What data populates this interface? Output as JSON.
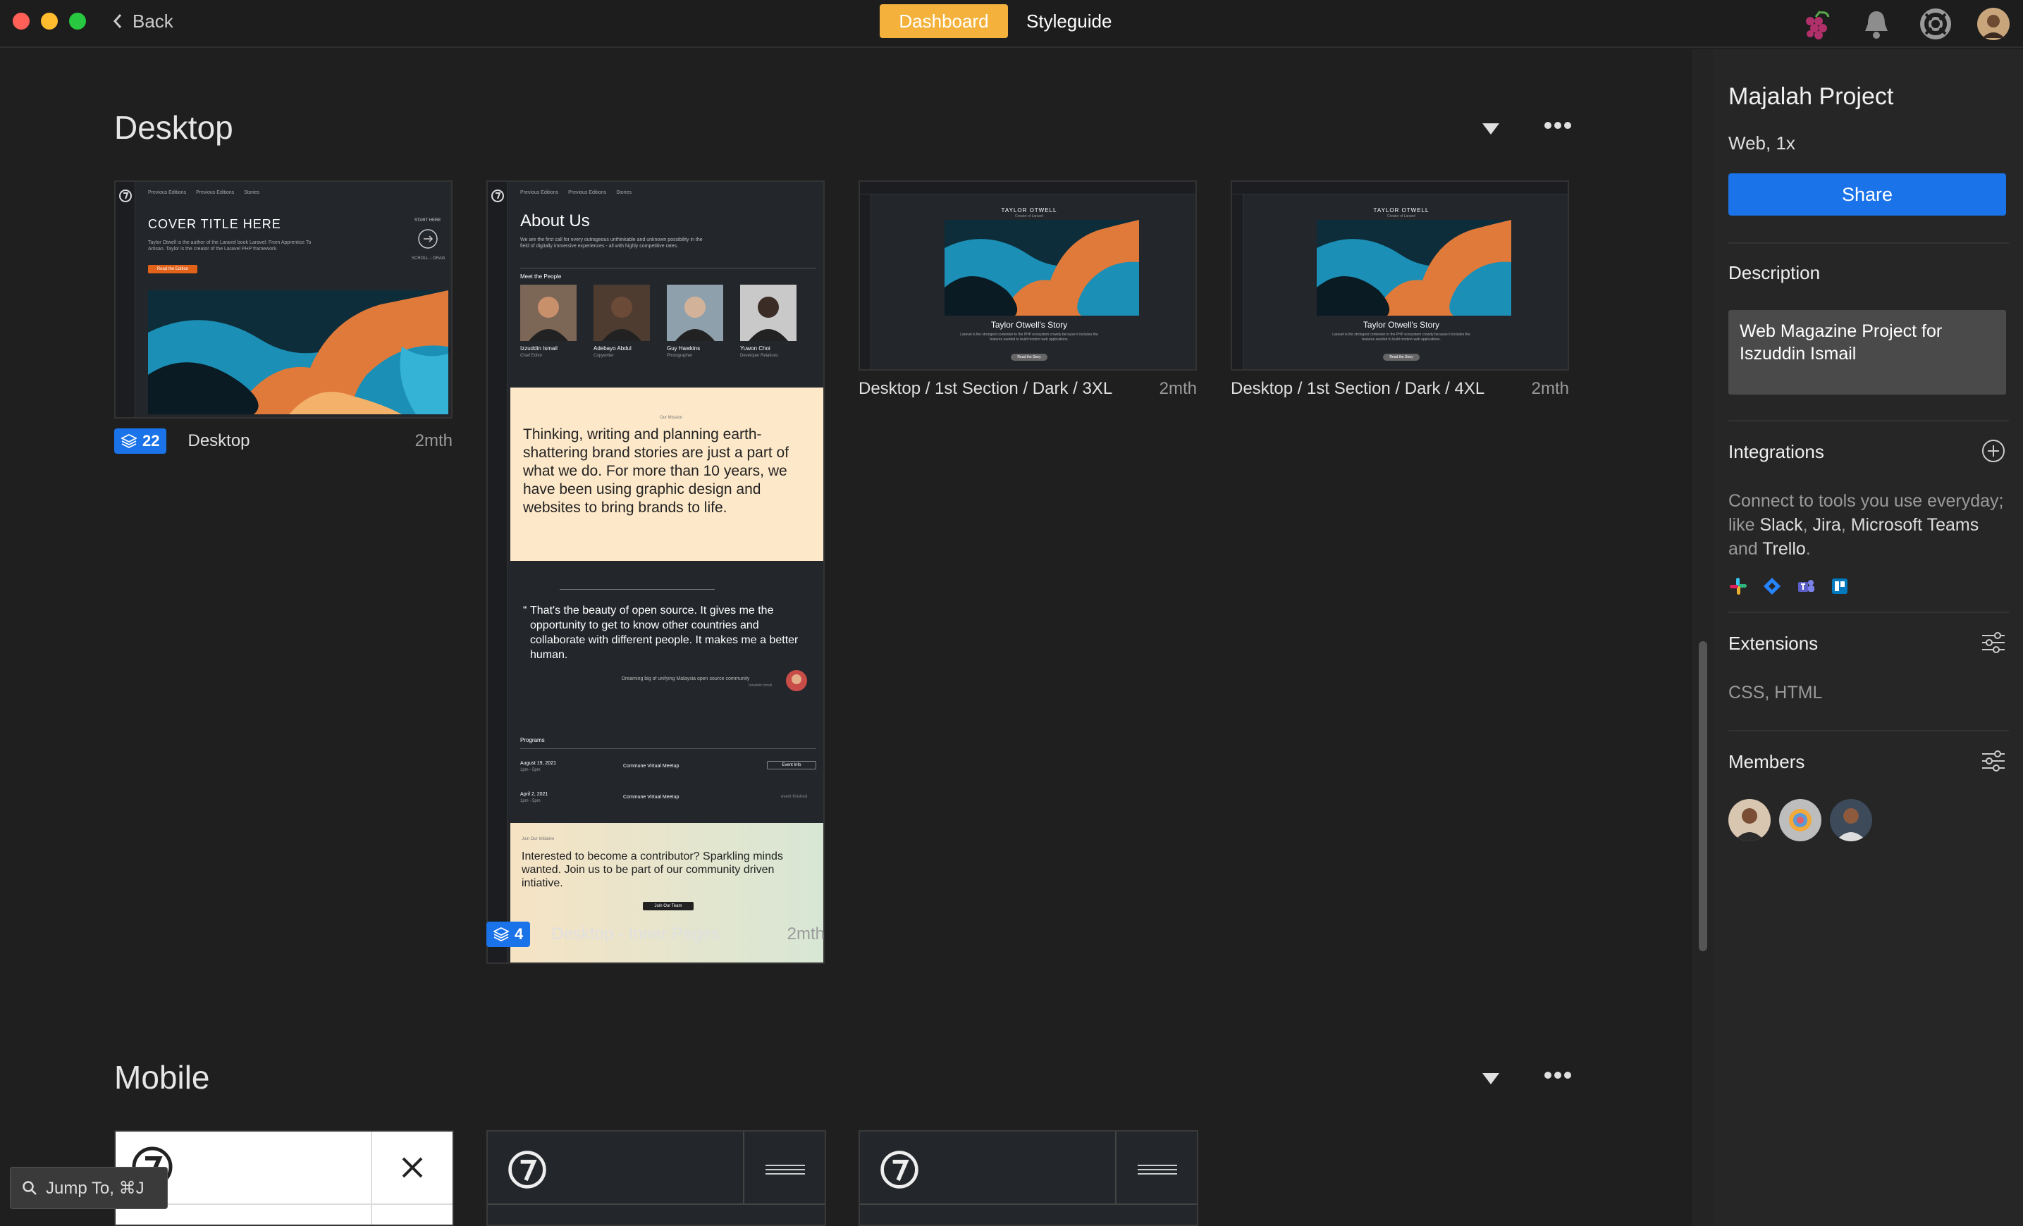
{
  "nav": {
    "back_label": "Back",
    "tab_dashboard": "Dashboard",
    "tab_styleguide": "Styleguide"
  },
  "sections": {
    "desktop": "Desktop",
    "mobile": "Mobile"
  },
  "cards": [
    {
      "name": "Desktop",
      "badge": "22",
      "time": "2mth"
    },
    {
      "name": "Desktop - Inner Pages",
      "badge": "4",
      "time": "2mth"
    },
    {
      "name": "Desktop / 1st Section / Dark / 3XL",
      "time": "2mth"
    },
    {
      "name": "Desktop / 1st Section / Dark / 4XL",
      "time": "2mth"
    }
  ],
  "previews": {
    "cover_title": "COVER TITLE HERE",
    "cover_body": "Taylor Otwell is the author of the Laravel book Laravel: From Apprentice To Artisan. Taylor is the creator of the Laravel PHP framework.",
    "cover_button": "Read the Edition",
    "cover_start": "START HERE",
    "cover_scroll": "SCROLL ↓ DRAG",
    "nav_links": [
      "Previous Editions",
      "Previous Editions",
      "Stories"
    ],
    "about_title": "About Us",
    "about_body": "We are the first call for every outrageous unthinkable and unknown possibility in the field of digitally immersive experiences - all with highly competitive rates.",
    "meet": "Meet the People",
    "people": [
      {
        "name": "Izzuddin Ismail",
        "role": "Chief Editor"
      },
      {
        "name": "Adebayo Abdul",
        "role": "Copywriter"
      },
      {
        "name": "Guy Hawkins",
        "role": "Photographer"
      },
      {
        "name": "Yuwon Choi",
        "role": "Developer Relations"
      }
    ],
    "mission": "Our Mission",
    "thinking": "Thinking, writing and planning earth-shattering brand stories are just a part of what we do. For more than 10 years, we have been using graphic design and websites to bring brands to life.",
    "quote": "That's the beauty of open source. It gives me the opportunity to get to know other countries and collaborate with different people. It makes me a better human.",
    "quote_attr": "Dreaming big of unifying Malaysia open source community",
    "quote_name": "Izzuddin Ismail",
    "programs": "Programs",
    "events": [
      {
        "date": "August 19, 2021",
        "time": "1pm - 5pm",
        "title": "Commune Virtual Meetup",
        "action": "Event Info"
      },
      {
        "date": "April 2, 2021",
        "time": "1pm - 5pm",
        "title": "Commune Virtual Meetup",
        "action": "event finished"
      }
    ],
    "join_kicker": "Join Our Initiative",
    "join_text": "Interested to become a contributor? Sparkling minds wanted. Join us to be part of our community driven intiative.",
    "join_button": "Join Our Team",
    "story_name": "TAYLOR OTWELL",
    "story_sub": "Creator of Laravel",
    "story_title": "Taylor Otwell's Story",
    "story_body": "Laravel is the strongest contender to the PHP ecosystem crowdy because it includes the features needed to build modern web applications.",
    "story_button": "Read the Story"
  },
  "panel": {
    "project": "Majalah Project",
    "meta": "Web, 1x",
    "share": "Share",
    "description_title": "Description",
    "description": "Web Magazine Project for Iszuddin Ismail",
    "integrations_title": "Integrations",
    "integrations_text_a": "Connect to tools you use everyday; like ",
    "integrations_slack": "Slack",
    "integrations_sep1": ", ",
    "integrations_jira": "Jira",
    "integrations_sep2": ", ",
    "integrations_teams": "Microsoft Teams",
    "integrations_and": " and ",
    "integrations_trello": "Trello",
    "integrations_end": ".",
    "extensions_title": "Extensions",
    "extensions": "CSS, HTML",
    "members_title": "Members"
  },
  "jump": "Jump To, ⌘J",
  "colors": {
    "accent": "#1a73e8",
    "dashboard": "#f4b23c",
    "background": "#1f1f1f",
    "panel": "#262626"
  }
}
